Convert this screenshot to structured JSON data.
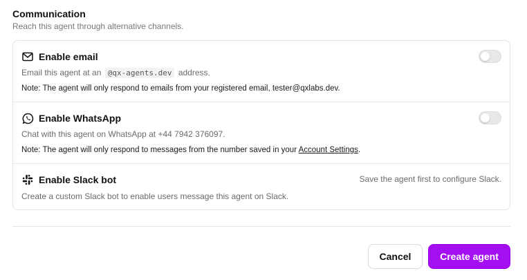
{
  "section": {
    "title": "Communication",
    "subtitle": "Reach this agent through alternative channels."
  },
  "email": {
    "icon": "mail-icon",
    "title": "Enable email",
    "desc_prefix": "Email this agent at an",
    "domain": "@qx-agents.dev",
    "desc_suffix": "address.",
    "note": "Note: The agent will only respond to emails from your registered email, tester@qxlabs.dev.",
    "enabled": false
  },
  "whatsapp": {
    "icon": "whatsapp-icon",
    "title": "Enable WhatsApp",
    "desc": "Chat with this agent on WhatsApp at +44 7942 376097.",
    "note_prefix": "Note: The agent will only respond to messages from the number saved in your",
    "note_link": "Account Settings",
    "note_suffix": ".",
    "enabled": false
  },
  "slack": {
    "icon": "slack-icon",
    "title": "Enable Slack bot",
    "hint": "Save the agent first to configure Slack.",
    "desc": "Create a custom Slack bot to enable users message this agent on Slack."
  },
  "actions": {
    "cancel_label": "Cancel",
    "create_label": "Create agent"
  },
  "colors": {
    "accent": "#a30ff0",
    "border": "#e4e4e7",
    "toggle_off": "#e8e8eb"
  }
}
